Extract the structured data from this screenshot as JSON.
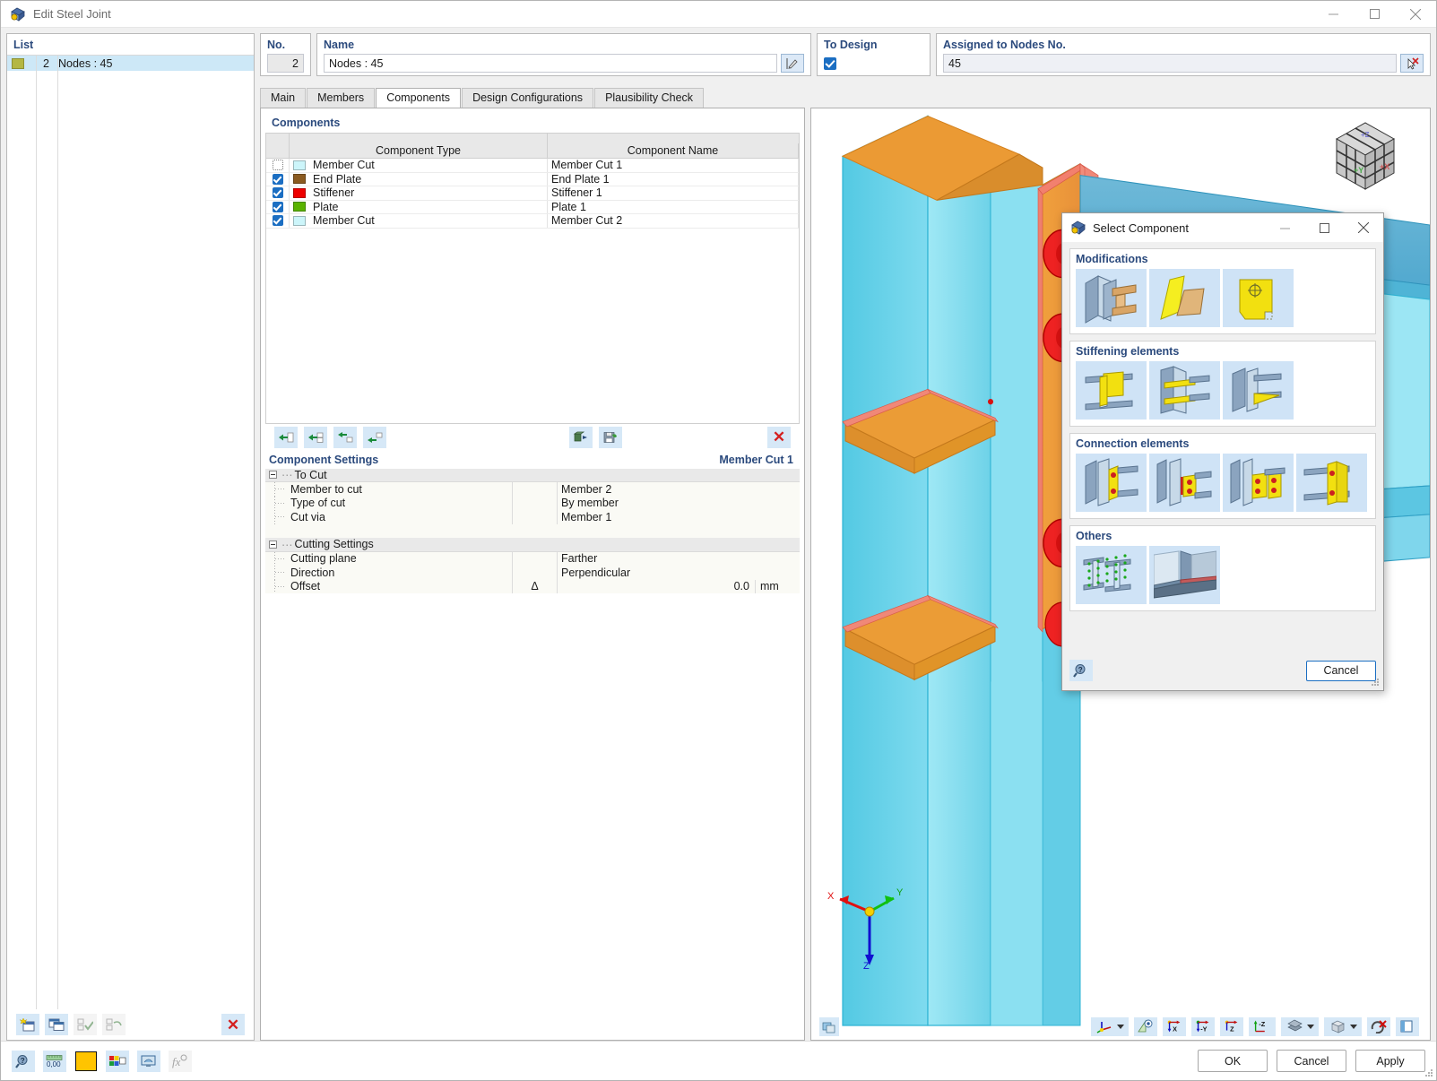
{
  "window": {
    "title": "Edit Steel Joint",
    "app_icon": "steel-joint-icon",
    "minimize": "–",
    "maximize": "☐",
    "close": "✕"
  },
  "list_panel": {
    "caption": "List",
    "rows": [
      {
        "number": "2",
        "label": "Nodes : 45",
        "color": "#b4b743"
      }
    ],
    "toolbar": [
      {
        "name": "new-joint-button",
        "icon": "new-window-icon"
      },
      {
        "name": "copy-joint-button",
        "icon": "copy-window-icon"
      },
      {
        "name": "select-all-button",
        "icon": "check-all-icon"
      },
      {
        "name": "invert-selection-button",
        "icon": "invert-check-icon"
      },
      {
        "name": "delete-joint-button",
        "icon": "red-x-icon"
      }
    ]
  },
  "header": {
    "no_label": "No.",
    "no_value": "2",
    "name_label": "Name",
    "name_value": "Nodes : 45",
    "name_edit_icon": "edit-pencil-icon",
    "to_design_label": "To Design",
    "to_design_checked": true,
    "nodes_label": "Assigned to Nodes No.",
    "nodes_value": "45",
    "nodes_pick_icon": "pick-cursor-icon"
  },
  "tabs": [
    {
      "label": "Main",
      "active": false
    },
    {
      "label": "Members",
      "active": false
    },
    {
      "label": "Components",
      "active": true
    },
    {
      "label": "Design Configurations",
      "active": false
    },
    {
      "label": "Plausibility Check",
      "active": false
    }
  ],
  "components_panel": {
    "caption": "Components",
    "columns": [
      "",
      "Component Type",
      "Component Name"
    ],
    "rows": [
      {
        "checked": false,
        "color": "#ccf5fa",
        "type": "Member Cut",
        "name": "Member Cut 1"
      },
      {
        "checked": true,
        "color": "#8a5a20",
        "type": "End Plate",
        "name": "End Plate 1"
      },
      {
        "checked": true,
        "color": "#ee0000",
        "type": "Stiffener",
        "name": "Stiffener 1"
      },
      {
        "checked": true,
        "color": "#59b200",
        "type": "Plate",
        "name": "Plate 1"
      },
      {
        "checked": true,
        "color": "#ccf5fa",
        "type": "Member Cut",
        "name": "Member Cut 2"
      }
    ],
    "toolbar": [
      {
        "name": "insert-component-button",
        "icon": "arrow-insert-icon"
      },
      {
        "name": "insert-component-after-button",
        "icon": "arrow-insert-after-icon"
      },
      {
        "name": "insert-above-button",
        "icon": "arrow-insert-above-icon"
      },
      {
        "name": "insert-below-button",
        "icon": "arrow-insert-below-icon"
      },
      {
        "name": "import-component-button",
        "icon": "import-icon"
      },
      {
        "name": "save-component-button",
        "icon": "save-disk-icon"
      },
      {
        "name": "delete-component-button",
        "icon": "red-x-icon"
      }
    ]
  },
  "component_settings": {
    "caption": "Component Settings",
    "current_component": "Member Cut 1",
    "groups": [
      {
        "title": "To Cut",
        "rows": [
          {
            "name": "Member to cut",
            "symbol": "",
            "value": "Member 2",
            "unit": ""
          },
          {
            "name": "Type of cut",
            "symbol": "",
            "value": "By member",
            "unit": ""
          },
          {
            "name": "Cut via",
            "symbol": "",
            "value": "Member 1",
            "unit": ""
          }
        ]
      },
      {
        "title": "Cutting Settings",
        "rows": [
          {
            "name": "Cutting plane",
            "symbol": "",
            "value": "Farther",
            "unit": ""
          },
          {
            "name": "Direction",
            "symbol": "",
            "value": "Perpendicular",
            "unit": ""
          },
          {
            "name": "Offset",
            "symbol": "Δ",
            "value": "0.0",
            "unit": "mm",
            "numeric": true
          }
        ]
      }
    ]
  },
  "viewport": {
    "axis_x": "X",
    "axis_y": "Y",
    "axis_z": "Z",
    "nav_cube_labels": [
      "+Y",
      "+X",
      "+Z"
    ],
    "corner_button": "render-mode-icon",
    "toolbar": [
      {
        "name": "coordinate-system-button",
        "icon": "axes-icon",
        "dropdown": true
      },
      {
        "name": "view-direction-button",
        "icon": "eye-plane-icon",
        "dropdown": false
      },
      {
        "name": "view-in-x-button",
        "icon": "axis-x-icon",
        "label": "X",
        "dropdown": false
      },
      {
        "name": "view-in-y-button",
        "icon": "axis-y-icon",
        "label": "-Y",
        "dropdown": false
      },
      {
        "name": "view-in-z-button",
        "icon": "axis-z-icon",
        "label": "Z",
        "dropdown": false
      },
      {
        "name": "view-minus-z-button",
        "icon": "axis-minus-z-icon",
        "label": "-Z",
        "dropdown": false
      },
      {
        "name": "render-style-button",
        "icon": "solid-model-icon",
        "dropdown": true
      },
      {
        "name": "wireframe-button",
        "icon": "wireframe-cube-icon",
        "dropdown": true
      },
      {
        "name": "clear-selection-button",
        "icon": "cursor-x-icon",
        "dropdown": false
      },
      {
        "name": "display-properties-button",
        "icon": "panel-icon",
        "dropdown": false
      }
    ]
  },
  "select_component_dialog": {
    "title": "Select Component",
    "icon": "steel-joint-icon",
    "minimize": "–",
    "maximize": "☐",
    "close": "✕",
    "groups": [
      {
        "title": "Modifications",
        "items": [
          {
            "name": "member-cut-thumb"
          },
          {
            "name": "plate-cut-thumb"
          },
          {
            "name": "opening-thumb"
          }
        ]
      },
      {
        "title": "Stiffening elements",
        "items": [
          {
            "name": "stiffener-thumb"
          },
          {
            "name": "double-stiffener-thumb"
          },
          {
            "name": "haunch-thumb"
          }
        ]
      },
      {
        "title": "Connection elements",
        "items": [
          {
            "name": "end-plate-thumb"
          },
          {
            "name": "fin-plate-thumb"
          },
          {
            "name": "web-plate-thumb"
          },
          {
            "name": "angle-cleat-thumb"
          }
        ]
      },
      {
        "title": "Others",
        "items": [
          {
            "name": "bolt-grid-thumb"
          },
          {
            "name": "weld-thumb"
          }
        ]
      }
    ],
    "help_icon": "help-magnifier-icon",
    "cancel_label": "Cancel"
  },
  "footer": {
    "toolbar": [
      {
        "name": "help-button",
        "icon": "help-magnifier-icon"
      },
      {
        "name": "units-button",
        "icon": "ruler-0-00-icon"
      },
      {
        "name": "color-button",
        "icon": "yellow-swatch-icon",
        "color": "#ffc400"
      },
      {
        "name": "display-settings-button",
        "icon": "colored-panel-icon"
      },
      {
        "name": "view-settings-button",
        "icon": "monitor-icon"
      },
      {
        "name": "formula-button",
        "icon": "fx-icon"
      }
    ],
    "ok_label": "OK",
    "cancel_label": "Cancel",
    "apply_label": "Apply"
  }
}
